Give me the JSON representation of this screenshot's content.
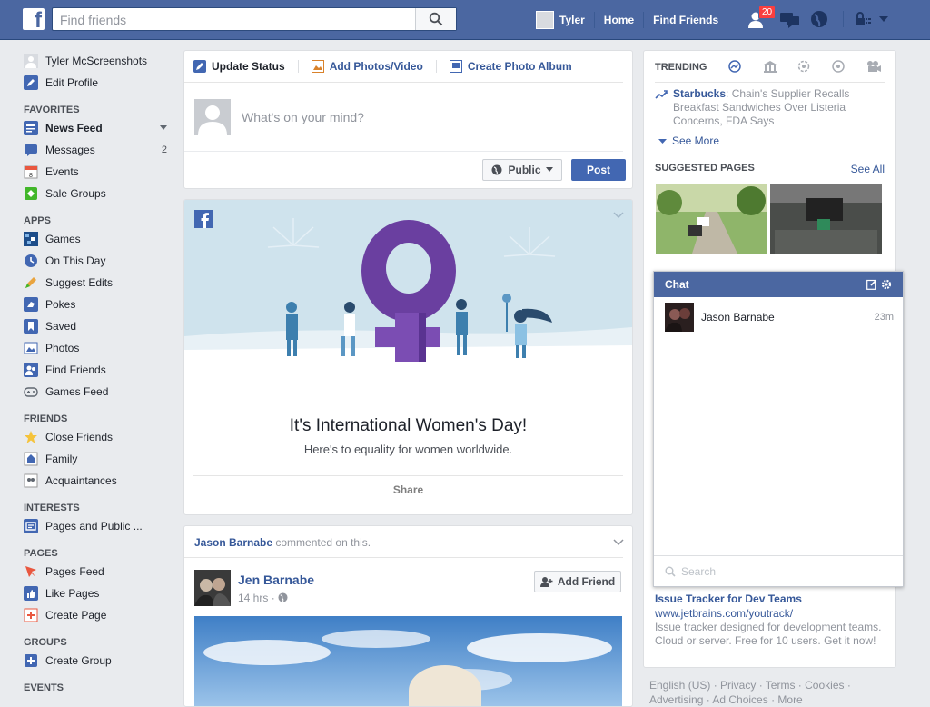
{
  "topbar": {
    "search_placeholder": "Find friends",
    "user_name": "Tyler",
    "home": "Home",
    "find_friends": "Find Friends",
    "friend_requests_count": "20"
  },
  "sidebar": {
    "profile_name": "Tyler McScreenshots",
    "edit_profile": "Edit Profile",
    "sections": [
      {
        "title": "FAVORITES",
        "items": [
          {
            "label": "News Feed",
            "icon": "news-feed-icon"
          },
          {
            "label": "Messages",
            "icon": "messages-icon",
            "count": "2"
          },
          {
            "label": "Events",
            "icon": "events-icon"
          },
          {
            "label": "Sale Groups",
            "icon": "sale-groups-icon"
          }
        ]
      },
      {
        "title": "APPS",
        "items": [
          {
            "label": "Games",
            "icon": "games-icon"
          },
          {
            "label": "On This Day",
            "icon": "on-this-day-icon"
          },
          {
            "label": "Suggest Edits",
            "icon": "suggest-edits-icon"
          },
          {
            "label": "Pokes",
            "icon": "pokes-icon"
          },
          {
            "label": "Saved",
            "icon": "saved-icon"
          },
          {
            "label": "Photos",
            "icon": "photos-icon"
          },
          {
            "label": "Find Friends",
            "icon": "find-friends-icon"
          },
          {
            "label": "Games Feed",
            "icon": "games-feed-icon"
          }
        ]
      },
      {
        "title": "FRIENDS",
        "items": [
          {
            "label": "Close Friends",
            "icon": "close-friends-icon"
          },
          {
            "label": "Family",
            "icon": "family-icon"
          },
          {
            "label": "Acquaintances",
            "icon": "acquaintances-icon"
          }
        ]
      },
      {
        "title": "INTERESTS",
        "items": [
          {
            "label": "Pages and Public ...",
            "icon": "pages-public-icon"
          }
        ]
      },
      {
        "title": "PAGES",
        "items": [
          {
            "label": "Pages Feed",
            "icon": "pages-feed-icon"
          },
          {
            "label": "Like Pages",
            "icon": "like-pages-icon"
          },
          {
            "label": "Create Page",
            "icon": "create-page-icon"
          }
        ]
      },
      {
        "title": "GROUPS",
        "items": [
          {
            "label": "Create Group",
            "icon": "create-group-icon"
          }
        ]
      },
      {
        "title": "EVENTS",
        "items": []
      }
    ]
  },
  "composer": {
    "tab_status": "Update Status",
    "tab_photos": "Add Photos/Video",
    "tab_album": "Create Photo Album",
    "placeholder": "What's on your mind?",
    "privacy": "Public",
    "post": "Post"
  },
  "iwd": {
    "title": "It's International Women's Day!",
    "subtitle": "Here's to equality for women worldwide.",
    "share": "Share"
  },
  "story": {
    "actor": "Jason Barnabe",
    "action": " commented on this.",
    "author": "Jen Barnabe",
    "time": "14 hrs",
    "add_friend": "Add Friend"
  },
  "trending": {
    "title": "TRENDING",
    "topic": "Starbucks",
    "headline": ": Chain's Supplier Recalls Breakfast Sandwiches Over Listeria Concerns, FDA Says",
    "see_more": "See More"
  },
  "suggested": {
    "title": "SUGGESTED PAGES",
    "see_all": "See All"
  },
  "chat": {
    "title": "Chat",
    "contact": "Jason Barnabe",
    "time": "23m",
    "search_placeholder": "Search"
  },
  "ad": {
    "title": "Issue Tracker for Dev Teams",
    "url": "www.jetbrains.com/youtrack/",
    "desc": "Issue tracker designed for development teams. Cloud or server. Free for 10 users. Get it now!"
  },
  "footer": {
    "line1": "English (US) · Privacy · Terms · Cookies ·",
    "line2": "Advertising · Ad Choices · More"
  },
  "colors": {
    "topbar": "#4b67a1",
    "link": "#365899",
    "post_button": "#4267b2",
    "badge": "#fa3e3e"
  }
}
